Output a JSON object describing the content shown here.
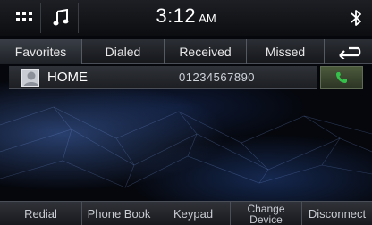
{
  "status_bar": {
    "time": "3:12",
    "ampm": "AM"
  },
  "icons": {
    "menu": "grid-menu-icon",
    "audio": "music-note-icon",
    "bluetooth": "bluetooth-icon",
    "back": "back-arrow-icon",
    "call": "phone-handset-icon",
    "avatar": "contact-avatar-icon"
  },
  "tabs": [
    {
      "label": "Favorites",
      "active": true
    },
    {
      "label": "Dialed",
      "active": false
    },
    {
      "label": "Received",
      "active": false
    },
    {
      "label": "Missed",
      "active": false
    }
  ],
  "contacts": [
    {
      "name": "HOME",
      "number": "01234567890"
    }
  ],
  "bottom_bar": [
    {
      "label": "Redial"
    },
    {
      "label": "Phone Book"
    },
    {
      "label": "Keypad"
    },
    {
      "label": "Change Device"
    },
    {
      "label": "Disconnect"
    }
  ],
  "colors": {
    "call_green": "#35c24a",
    "background": "#05070d"
  }
}
